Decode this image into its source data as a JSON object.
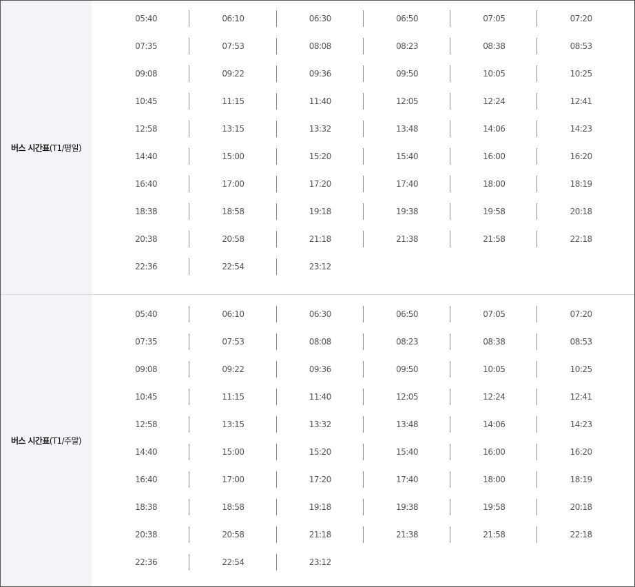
{
  "timetables": [
    {
      "title_bold": "버스 시간표",
      "title_paren": "(T1/평일)",
      "rows": [
        [
          "05:40",
          "06:10",
          "06:30",
          "06:50",
          "07:05",
          "07:20"
        ],
        [
          "07:35",
          "07:53",
          "08:08",
          "08:23",
          "08:38",
          "08:53"
        ],
        [
          "09:08",
          "09:22",
          "09:36",
          "09:50",
          "10:05",
          "10:25"
        ],
        [
          "10:45",
          "11:15",
          "11:40",
          "12:05",
          "12:24",
          "12:41"
        ],
        [
          "12:58",
          "13:15",
          "13:32",
          "13:48",
          "14:06",
          "14:23"
        ],
        [
          "14:40",
          "15:00",
          "15:20",
          "15:40",
          "16:00",
          "16:20"
        ],
        [
          "16:40",
          "17:00",
          "17:20",
          "17:40",
          "18:00",
          "18:19"
        ],
        [
          "18:38",
          "18:58",
          "19:18",
          "19:38",
          "19:58",
          "20:18"
        ],
        [
          "20:38",
          "20:58",
          "21:18",
          "21:38",
          "21:58",
          "22:18"
        ],
        [
          "22:36",
          "22:54",
          "23:12"
        ]
      ]
    },
    {
      "title_bold": "버스 시간표",
      "title_paren": "(T1/주말)",
      "rows": [
        [
          "05:40",
          "06:10",
          "06:30",
          "06:50",
          "07:05",
          "07:20"
        ],
        [
          "07:35",
          "07:53",
          "08:08",
          "08:23",
          "08:38",
          "08:53"
        ],
        [
          "09:08",
          "09:22",
          "09:36",
          "09:50",
          "10:05",
          "10:25"
        ],
        [
          "10:45",
          "11:15",
          "11:40",
          "12:05",
          "12:24",
          "12:41"
        ],
        [
          "12:58",
          "13:15",
          "13:32",
          "13:48",
          "14:06",
          "14:23"
        ],
        [
          "14:40",
          "15:00",
          "15:20",
          "15:40",
          "16:00",
          "16:20"
        ],
        [
          "16:40",
          "17:00",
          "17:20",
          "17:40",
          "18:00",
          "18:19"
        ],
        [
          "18:38",
          "18:58",
          "19:18",
          "19:38",
          "19:58",
          "20:18"
        ],
        [
          "20:38",
          "20:58",
          "21:18",
          "21:38",
          "21:58",
          "22:18"
        ],
        [
          "22:36",
          "22:54",
          "23:12"
        ]
      ]
    }
  ]
}
